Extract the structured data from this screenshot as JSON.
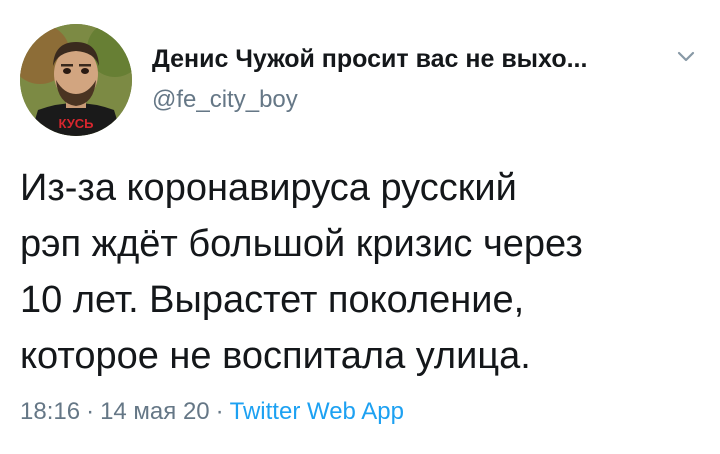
{
  "tweet": {
    "author": {
      "display_name": "Денис Чужой просит вас не выхо...",
      "handle": "@fe_city_boy",
      "avatar_shirt_text": "КУСЬ"
    },
    "text": "Из-за коронавируса русский\nрэп ждёт большой кризис через\n10 лет. Вырастет поколение,\nкоторое не воспитала улица.",
    "time": "18:16",
    "date": "14 мая 20",
    "separator": "·",
    "source": "Twitter Web App"
  },
  "icons": {
    "caret": "chevron-down-icon",
    "avatar": "avatar"
  },
  "colors": {
    "text_primary": "#14171a",
    "text_secondary": "#657786",
    "link": "#1da1f2"
  }
}
